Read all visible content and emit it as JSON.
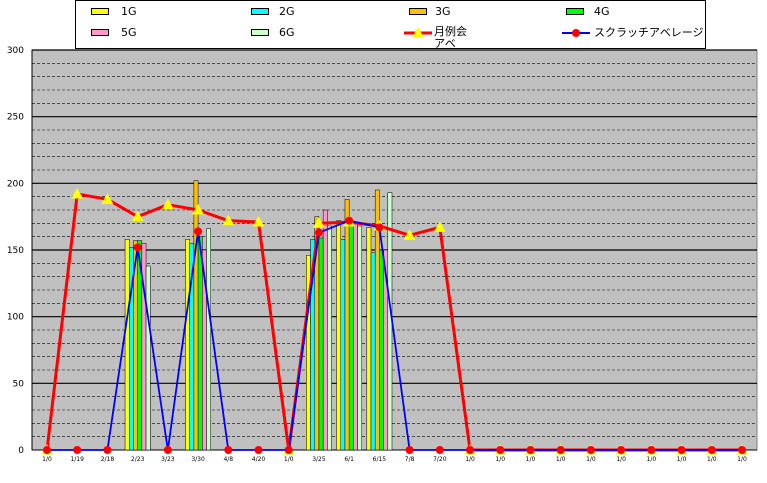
{
  "chart_data": {
    "type": "bar",
    "categories": [
      "1/0",
      "1/19",
      "2/18",
      "2/23",
      "3/23",
      "3/30",
      "4/8",
      "4/20",
      "1/0",
      "3/25",
      "6/1",
      "6/15",
      "7/8",
      "7/20",
      "1/0",
      "1/0",
      "1/0",
      "1/0",
      "1/0",
      "1/0",
      "1/0",
      "1/0",
      "1/0",
      "1/0"
    ],
    "ylim": [
      0,
      300
    ],
    "yticks": [
      0,
      50,
      100,
      150,
      200,
      250,
      300
    ],
    "grid": true,
    "legend_position": "top",
    "series": [
      {
        "name": "1G",
        "kind": "bar",
        "color": "#ffff00",
        "values": [
          0,
          0,
          0,
          158,
          0,
          158,
          0,
          0,
          0,
          146,
          172,
          167,
          0,
          0,
          0,
          0,
          0,
          0,
          0,
          0,
          0,
          0,
          0,
          0
        ]
      },
      {
        "name": "2G",
        "kind": "bar",
        "color": "#00ffff",
        "values": [
          0,
          0,
          0,
          152,
          0,
          155,
          0,
          0,
          0,
          158,
          158,
          148,
          0,
          0,
          0,
          0,
          0,
          0,
          0,
          0,
          0,
          0,
          0,
          0
        ]
      },
      {
        "name": "3G",
        "kind": "bar",
        "color": "#ffc000",
        "values": [
          0,
          0,
          0,
          157,
          0,
          202,
          0,
          0,
          0,
          175,
          188,
          195,
          0,
          0,
          0,
          0,
          0,
          0,
          0,
          0,
          0,
          0,
          0,
          0
        ]
      },
      {
        "name": "4G",
        "kind": "bar",
        "color": "#00ff00",
        "values": [
          0,
          0,
          0,
          157,
          0,
          160,
          0,
          0,
          0,
          159,
          170,
          150,
          0,
          0,
          0,
          0,
          0,
          0,
          0,
          0,
          0,
          0,
          0,
          0
        ]
      },
      {
        "name": "5G",
        "kind": "bar",
        "color": "#ff99cc",
        "values": [
          0,
          0,
          0,
          155,
          0,
          150,
          0,
          0,
          0,
          180,
          170,
          150,
          0,
          0,
          0,
          0,
          0,
          0,
          0,
          0,
          0,
          0,
          0,
          0
        ]
      },
      {
        "name": "6G",
        "kind": "bar",
        "color": "#ccffcc",
        "values": [
          0,
          0,
          0,
          138,
          0,
          166,
          0,
          0,
          0,
          168,
          168,
          193,
          0,
          0,
          0,
          0,
          0,
          0,
          0,
          0,
          0,
          0,
          0,
          0
        ]
      },
      {
        "name": "月例会アベ",
        "kind": "line",
        "color": "#ff0000",
        "marker": "triangle",
        "markerColor": "#ffff00",
        "values": [
          0,
          192,
          188,
          175,
          184,
          180,
          172,
          171,
          0,
          170,
          171,
          168,
          161,
          167,
          0,
          0,
          0,
          0,
          0,
          0,
          0,
          0,
          0,
          0
        ]
      },
      {
        "name": "スクラッチアベレージ",
        "kind": "line",
        "color": "#0000ff",
        "marker": "circle",
        "markerColor": "#ff0000",
        "values": [
          0,
          0,
          0,
          152,
          0,
          164,
          0,
          0,
          0,
          163,
          172,
          167,
          0,
          0,
          0,
          0,
          0,
          0,
          0,
          0,
          0,
          0,
          0,
          0
        ]
      }
    ]
  }
}
